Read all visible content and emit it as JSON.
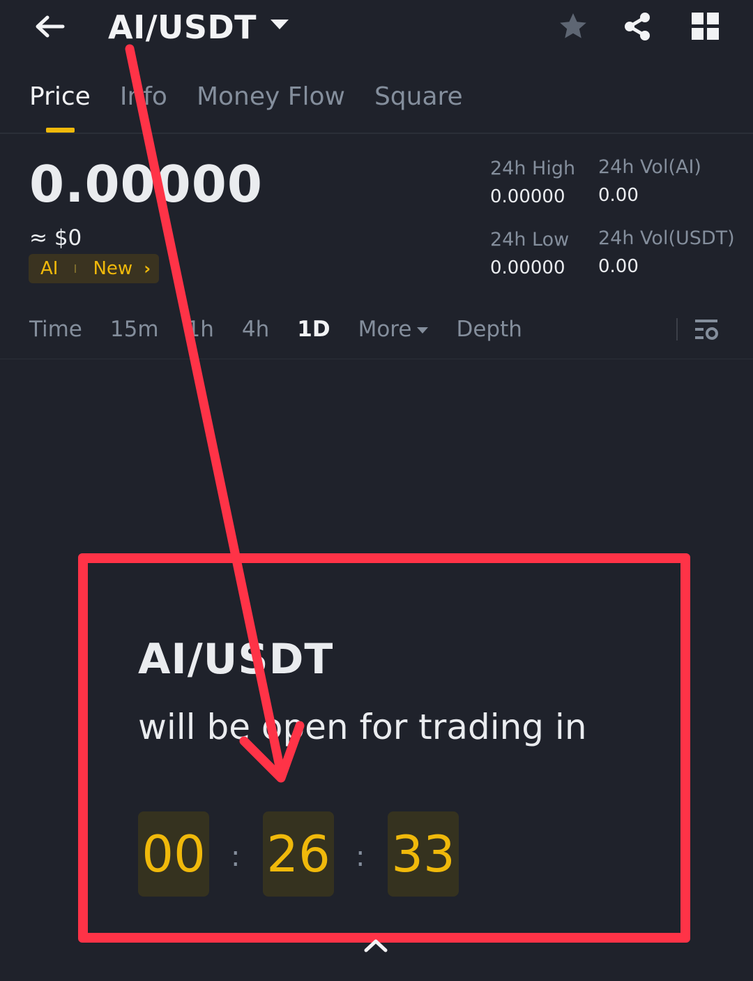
{
  "header": {
    "pair": "AI/USDT",
    "icons": [
      "back-arrow-icon",
      "caret-down-icon",
      "star-icon",
      "share-icon",
      "grid-icon"
    ]
  },
  "tabs": [
    {
      "label": "Price",
      "active": true
    },
    {
      "label": "Info",
      "active": false
    },
    {
      "label": "Money Flow",
      "active": false
    },
    {
      "label": "Square",
      "active": false
    }
  ],
  "price": {
    "last": "0.00000",
    "approx": "≈ $0",
    "tag_coin": "AI",
    "tag_status": "New"
  },
  "stats": {
    "high_label": "24h High",
    "high_value": "0.00000",
    "low_label": "24h Low",
    "low_value": "0.00000",
    "vol_base_label": "24h Vol(AI)",
    "vol_base_value": "0.00",
    "vol_quote_label": "24h Vol(USDT)",
    "vol_quote_value": "0.00"
  },
  "intervals": [
    {
      "label": "Time",
      "active": false
    },
    {
      "label": "15m",
      "active": false
    },
    {
      "label": "1h",
      "active": false
    },
    {
      "label": "4h",
      "active": false
    },
    {
      "label": "1D",
      "active": true
    },
    {
      "label": "More",
      "active": false
    },
    {
      "label": "Depth",
      "active": false
    }
  ],
  "notice": {
    "pair": "AI/USDT",
    "text": "will be open for trading in",
    "hours": "00",
    "minutes": "26",
    "seconds": "33",
    "separator": ":"
  },
  "colors": {
    "background": "#1f222b",
    "accent": "#f0b90b",
    "annotation": "#ff3347",
    "muted": "#848e9c"
  }
}
